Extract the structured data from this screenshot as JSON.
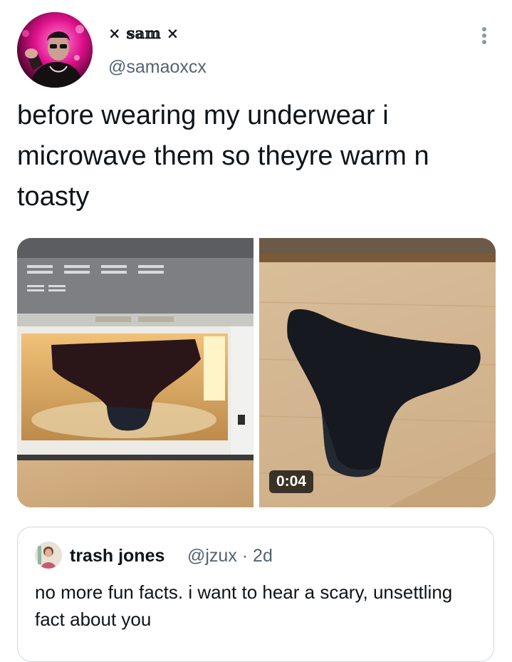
{
  "author": {
    "display_name": "× 𝕤𝕒𝕞 ×",
    "handle": "@samaoxcx",
    "avatar_icon": "profile-photo"
  },
  "tweet": {
    "text": "before wearing my underwear i microwave them so theyre warm n toasty"
  },
  "media": {
    "left_image": "underwear-in-microwave-photo",
    "right_image": "underwear-on-floor-video",
    "video_duration": "0:04"
  },
  "quote": {
    "display_name": "trash jones",
    "meta": "@jzux · 2d",
    "text": "no more fun facts. i want to hear a scary, unsettling fact about you"
  },
  "colors": {
    "text_primary": "#0f1419",
    "text_secondary": "#536471",
    "border": "#cfd9de",
    "avatar_pink": "#e0108c"
  },
  "icons": {
    "more": "more-vertical-icon"
  }
}
